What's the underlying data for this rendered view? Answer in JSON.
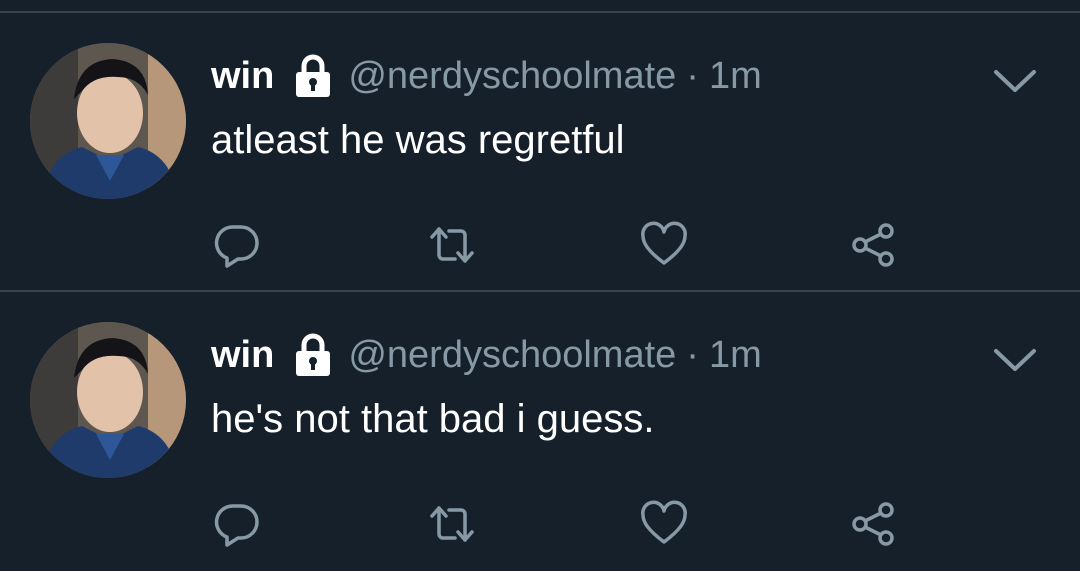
{
  "colors": {
    "background": "#15202b",
    "divider": "#38444d",
    "text_primary": "#ffffff",
    "text_secondary": "#8899a6"
  },
  "tweets": [
    {
      "name": "win",
      "handle": "@nerdyschoolmate",
      "separator": "·",
      "time": "1m",
      "protected": true,
      "text": "atleast he was regretful",
      "icons": [
        "lock-icon",
        "chevron-down-icon",
        "reply-icon",
        "retweet-icon",
        "heart-icon",
        "share-icon"
      ]
    },
    {
      "name": "win",
      "handle": "@nerdyschoolmate",
      "separator": "·",
      "time": "1m",
      "protected": true,
      "text": "he's not that bad i guess.",
      "icons": [
        "lock-icon",
        "chevron-down-icon",
        "reply-icon",
        "retweet-icon",
        "heart-icon",
        "share-icon"
      ]
    }
  ]
}
